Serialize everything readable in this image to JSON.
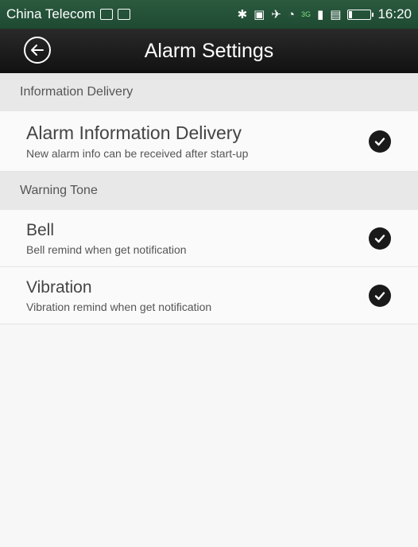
{
  "status_bar": {
    "carrier": "China Telecom",
    "network": "3G",
    "time": "16:20"
  },
  "app_bar": {
    "title": "Alarm Settings"
  },
  "sections": [
    {
      "header": "Information Delivery",
      "items": [
        {
          "title": "Alarm Information Delivery",
          "subtitle": "New alarm info can be received after start-up",
          "checked": true
        }
      ]
    },
    {
      "header": "Warning Tone",
      "items": [
        {
          "title": "Bell",
          "subtitle": "Bell remind when get notification",
          "checked": true
        },
        {
          "title": "Vibration",
          "subtitle": "Vibration remind when get notification",
          "checked": true
        }
      ]
    }
  ],
  "icons": {
    "back": "back-arrow-icon",
    "check": "checkmark-icon"
  },
  "colors": {
    "status_bar": "#234f38",
    "app_bar": "#1c1c1c",
    "check_fill": "#1a1a1a"
  }
}
